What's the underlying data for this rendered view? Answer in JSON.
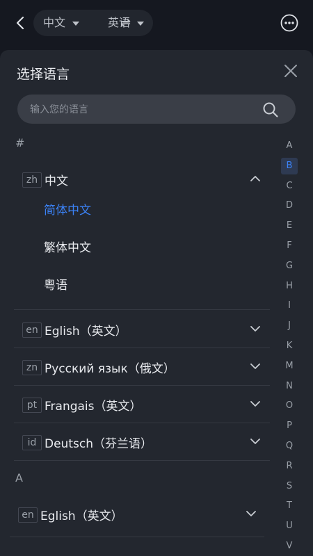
{
  "header": {
    "source_lang": "中文",
    "swap_symbol": "⇌",
    "target_lang": "英语"
  },
  "sheet": {
    "title": "选择语言",
    "search_placeholder": "输入您的语言"
  },
  "sections": [
    {
      "header": "#"
    },
    {
      "header": "A"
    }
  ],
  "languages": [
    {
      "code": "zh",
      "label": "中文"
    },
    {
      "code": "en",
      "label": "Eglish（英文）"
    },
    {
      "code": "zn",
      "label": "Русский язык（俄文）"
    },
    {
      "code": "pt",
      "label": "Frangais（英文）"
    },
    {
      "code": "id",
      "label": "Deutsch（芬兰语）"
    },
    {
      "code": "en",
      "label": "Eglish（英文）"
    }
  ],
  "sub_items": [
    "简体中文",
    "繁体中文",
    "粤语"
  ],
  "index_letters": [
    "A",
    "B",
    "C",
    "D",
    "E",
    "F",
    "G",
    "H",
    "I",
    "J",
    "K",
    "M",
    "N",
    "O",
    "P",
    "Q",
    "R",
    "S",
    "T",
    "U",
    "V"
  ],
  "active_index_letter": "B",
  "colors": {
    "accent": "#3b82f6",
    "background": "#151820",
    "sheet": "#23272f"
  }
}
